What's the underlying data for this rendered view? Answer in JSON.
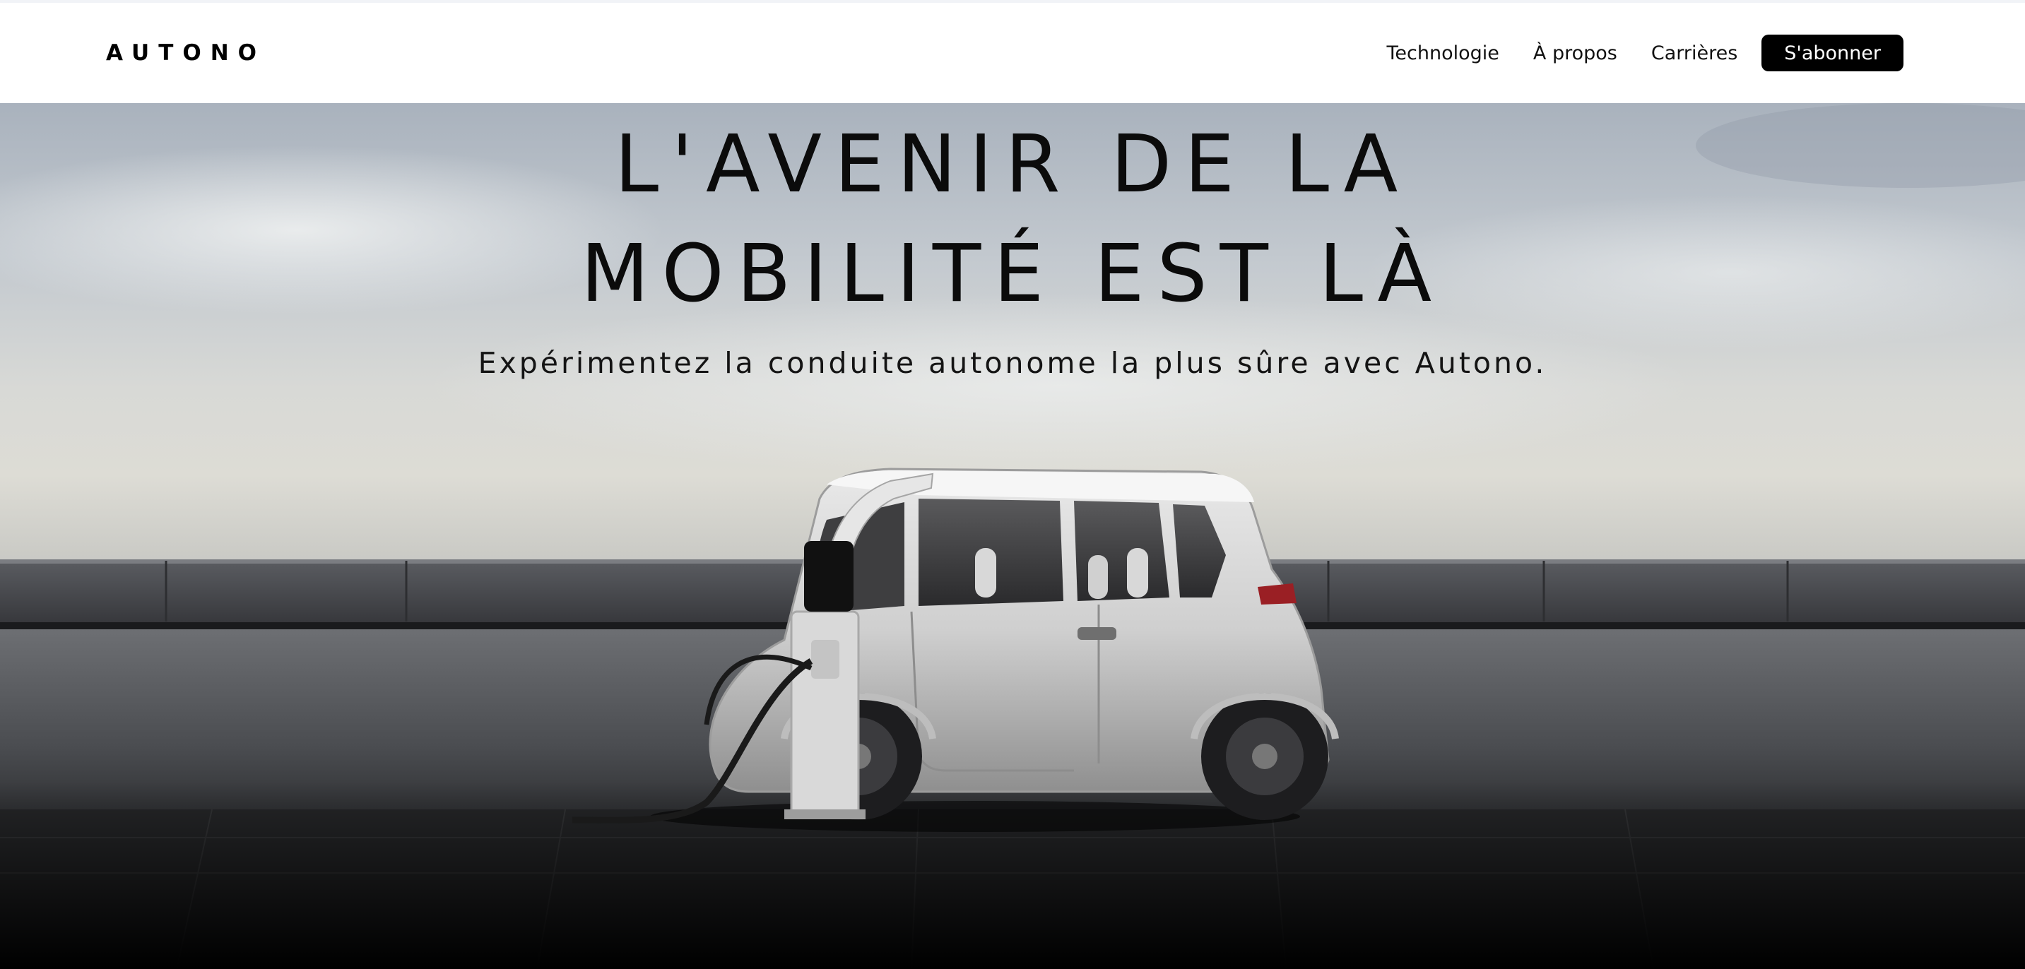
{
  "brand": {
    "logo_text": "AUTONO"
  },
  "nav": {
    "items": [
      {
        "label": "Technologie"
      },
      {
        "label": "À propos"
      },
      {
        "label": "Carrières"
      }
    ],
    "cta_label": "S'abonner"
  },
  "hero": {
    "title_line1": "L'AVENIR DE LA",
    "title_line2": "MOBILITÉ EST LÀ",
    "subtitle": "Expérimentez la conduite autonome la plus sûre avec Autono.",
    "image_subject": "electric-microcar-charging"
  },
  "colors": {
    "header_bg": "#ffffff",
    "button_bg": "#000000",
    "button_text": "#ffffff",
    "text_dark": "#0b0b0b"
  }
}
